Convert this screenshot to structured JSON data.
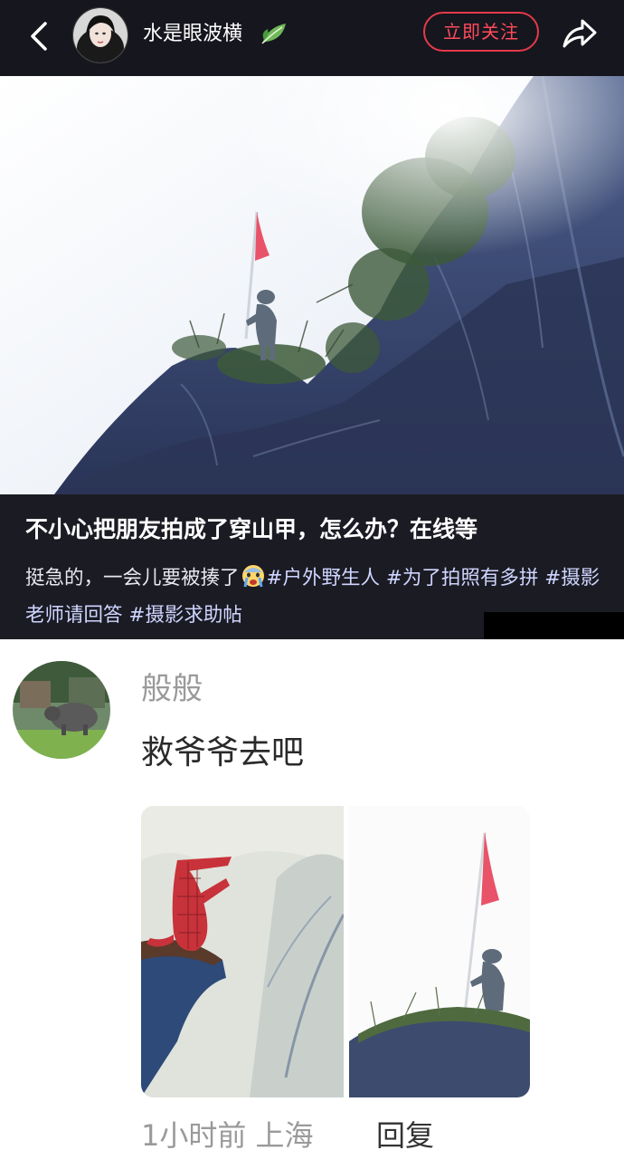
{
  "header": {
    "username": "水是眼波横",
    "follow_label": "立即关注"
  },
  "post": {
    "title": "不小心把朋友拍成了穿山甲，怎么办？在线等",
    "body_text": "挺急的，一会儿要被揍了",
    "hashtags": [
      "#户外野生人",
      "#为了拍照有多拼",
      "#摄影老师请回答",
      "#摄影求助帖"
    ],
    "emoji": "crying-face-emoji"
  },
  "comment": {
    "author": "般般",
    "text": "救爷爷去吧",
    "time": "1小时前",
    "location": "上海",
    "reply_label": "回复"
  },
  "colors": {
    "topbar_bg": "#16161e",
    "caption_bg": "#1b1b24",
    "follow_accent": "#e53a4a",
    "hashtag": "#cfd6ff",
    "flag": "#e8536a"
  },
  "icons": {
    "back": "chevron-left-icon",
    "share": "share-arrow-icon",
    "name_badge": "leaf-icon"
  }
}
